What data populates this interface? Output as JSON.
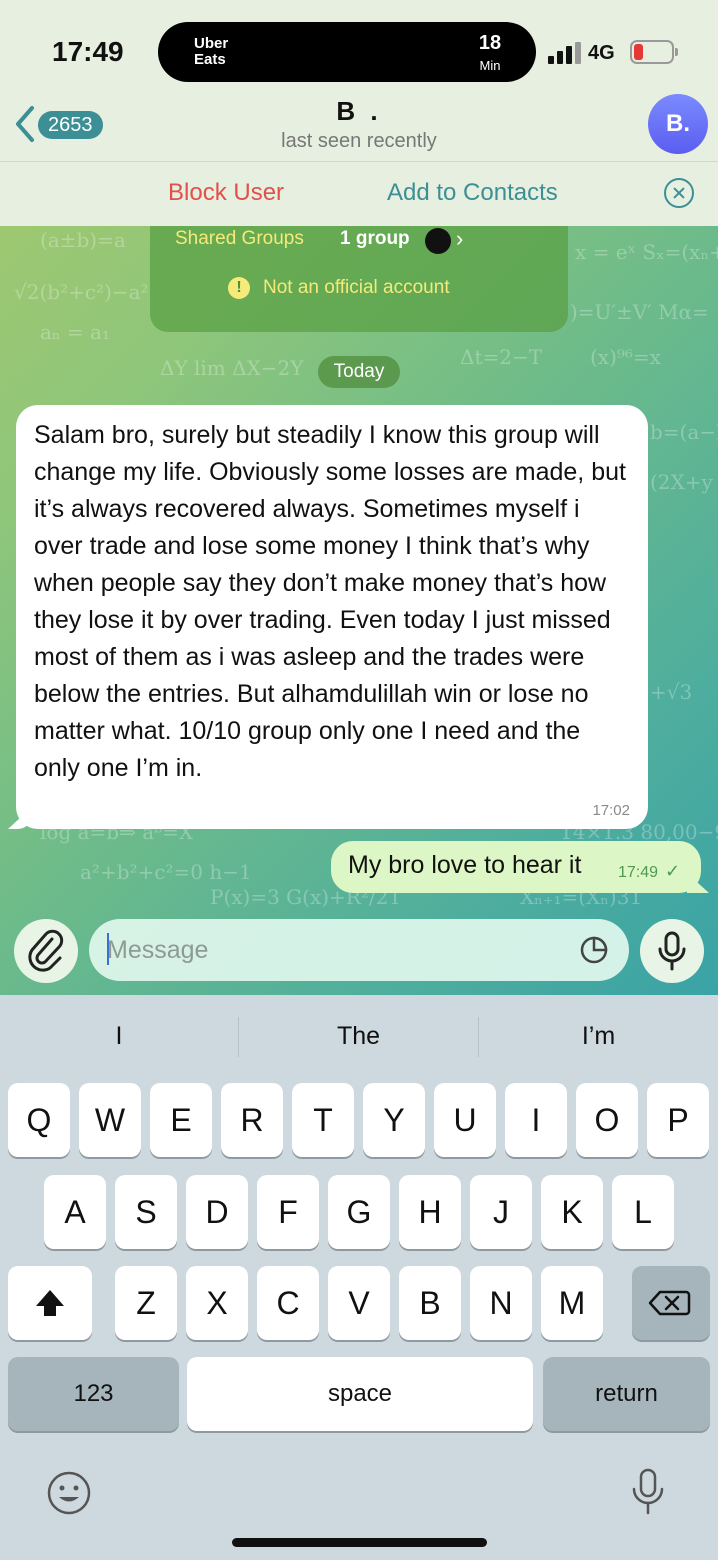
{
  "status_bar": {
    "time": "17:49",
    "live_activity": {
      "app": "Uber Eats",
      "value": "18",
      "unit": "Min"
    },
    "network": "4G"
  },
  "header": {
    "unread_count": "2653",
    "title": "B .",
    "subtitle": "last seen recently",
    "avatar_initials": "B."
  },
  "actions": {
    "block": "Block User",
    "add_contacts": "Add to Contacts"
  },
  "info_card": {
    "shared_groups_label": "Shared Groups",
    "shared_groups_value": "1 group",
    "warning": "Not an official account"
  },
  "date_separator": "Today",
  "messages": [
    {
      "direction": "incoming",
      "text": "Salam bro, surely but steadily I know this group will change my life. Obviously some losses are made, but it’s always recovered always. Sometimes myself i over trade and lose some money I think that’s why when people say they don’t make money that’s how they lose it by over trading. Even today I just missed most of them as i was asleep and the trades were below the entries. But alhamdulillah win or lose no matter what. 10/10 group only one I need and the only one I’m in.",
      "time": "17:02"
    },
    {
      "direction": "outgoing",
      "text": "My bro love to hear it",
      "time": "17:49"
    }
  ],
  "composer": {
    "placeholder": "Message"
  },
  "keyboard": {
    "suggestions": [
      "I",
      "The",
      "I’m"
    ],
    "row1": [
      "Q",
      "W",
      "E",
      "R",
      "T",
      "Y",
      "U",
      "I",
      "O",
      "P"
    ],
    "row2": [
      "A",
      "S",
      "D",
      "F",
      "G",
      "H",
      "J",
      "K",
      "L"
    ],
    "row3": [
      "Z",
      "X",
      "C",
      "V",
      "B",
      "N",
      "M"
    ],
    "numbers_key": "123",
    "space_key": "space",
    "return_key": "return"
  },
  "colors": {
    "accent": "#3c8f95",
    "danger": "#e0514a",
    "outgoing_bubble": "#dcf7c5",
    "avatar": "#6b72f5"
  }
}
